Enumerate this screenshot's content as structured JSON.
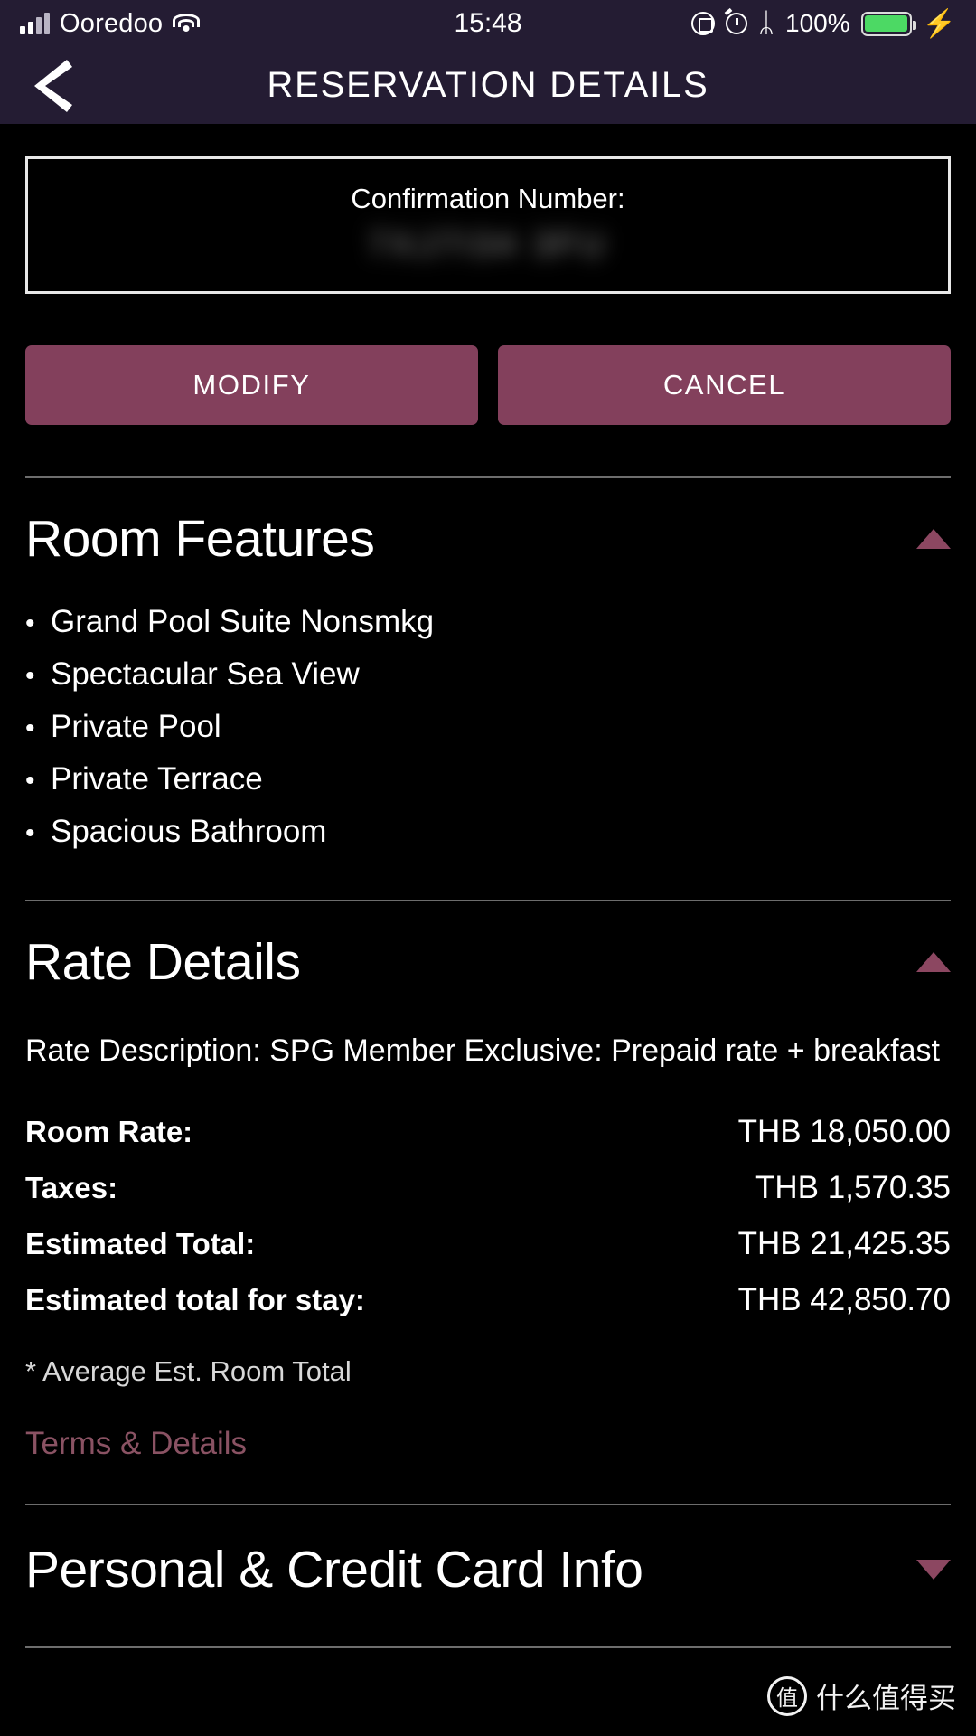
{
  "status_bar": {
    "carrier": "Ooredoo",
    "time": "15:48",
    "battery_percent": "100%",
    "wifi_icon": "wifi-icon",
    "signal_icon": "signal-bars-icon",
    "rotation_lock_icon": "rotation-lock-icon",
    "alarm_icon": "alarm-clock-icon",
    "bluetooth_icon": "bluetooth-icon",
    "bluetooth_glyph": "ᛦ",
    "battery_icon": "battery-icon",
    "charging_glyph": "⚡"
  },
  "header": {
    "title": "RESERVATION DETAILS",
    "back_icon": "back-chevron-icon",
    "background": "#241c33"
  },
  "confirmation": {
    "label": "Confirmation Number:",
    "value": "7XJ7I34 3FU"
  },
  "actions": {
    "modify_label": "MODIFY",
    "cancel_label": "CANCEL",
    "button_color": "#83405c"
  },
  "room_features": {
    "title": "Room Features",
    "expanded": true,
    "chevron_icon": "chevron-up-icon",
    "chevron_color": "#8c4761",
    "items": [
      "Grand Pool Suite Nonsmkg",
      "Spectacular Sea View",
      "Private Pool",
      "Private Terrace",
      "Spacious Bathroom"
    ],
    "bullet": "•"
  },
  "rate_details": {
    "title": "Rate Details",
    "expanded": true,
    "chevron_icon": "chevron-up-icon",
    "description": "Rate Description: SPG Member Exclusive: Prepaid rate + breakfast",
    "rows": [
      {
        "label": "Room Rate:",
        "value": "THB 18,050.00"
      },
      {
        "label": "Taxes:",
        "value": "THB 1,570.35"
      },
      {
        "label": "Estimated Total:",
        "value": "THB 21,425.35"
      },
      {
        "label": "Estimated total for stay:",
        "value": "THB 42,850.70"
      }
    ],
    "footnote": "* Average Est. Room Total",
    "terms_link": "Terms & Details",
    "terms_link_color": "#8a5263"
  },
  "personal_section": {
    "title": "Personal & Credit Card Info",
    "expanded": false,
    "chevron_icon": "chevron-down-icon"
  },
  "watermark": {
    "badge": "值",
    "text": "什么值得买"
  }
}
